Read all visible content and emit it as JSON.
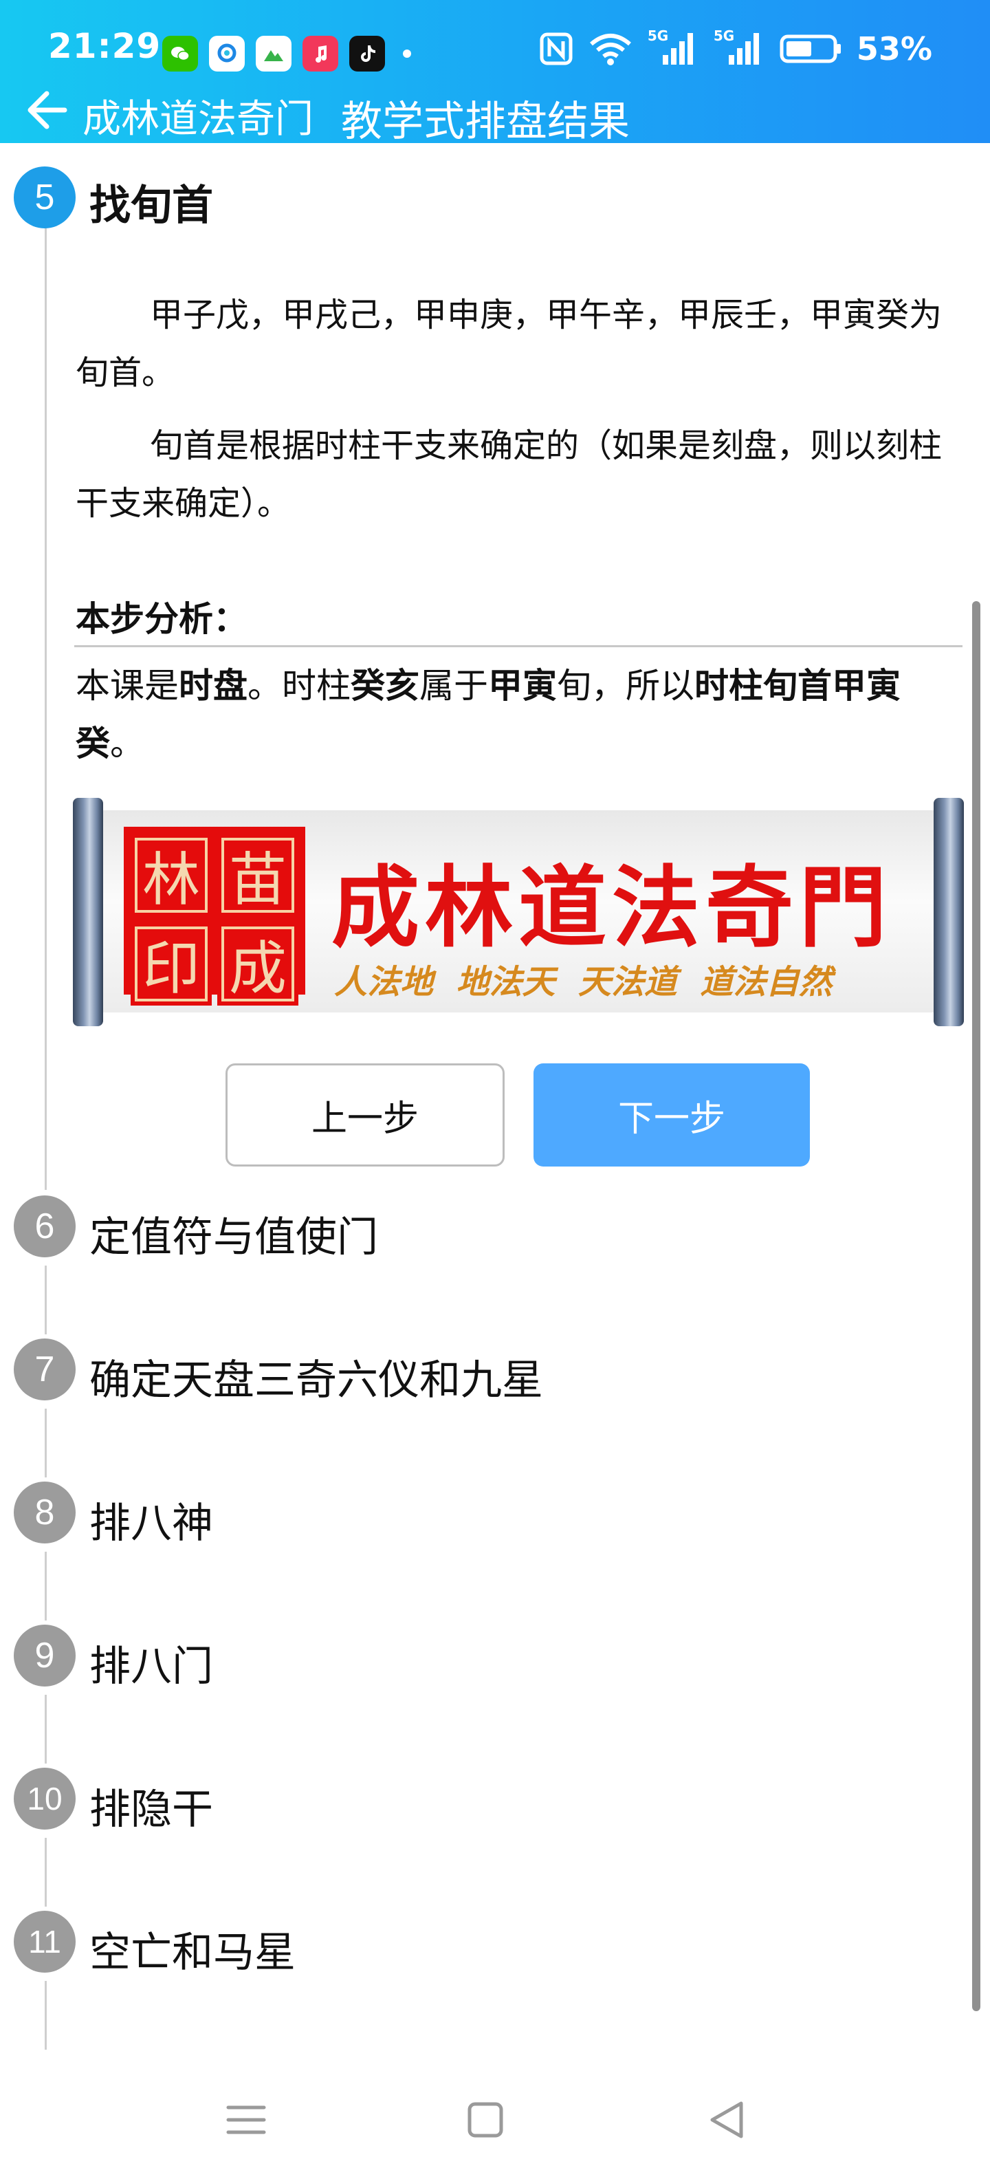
{
  "status_bar": {
    "time": "21:29",
    "notification_apps": [
      "wechat-icon",
      "qq-browser-icon",
      "photos-icon",
      "music-icon",
      "tiktok-icon"
    ],
    "network_1": "5G",
    "network_2": "5G",
    "battery": "53%"
  },
  "header": {
    "back_icon": "arrow-left-icon",
    "app_name": "成林道法奇门",
    "page_title": "教学式排盘结果"
  },
  "current_step": {
    "number": "5",
    "title": "找旬首",
    "paragraph_1": "甲子戊，甲戌己，甲申庚，甲午辛，甲辰壬，甲寅癸为旬首。",
    "paragraph_2": "旬首是根据时柱干支来确定的（如果是刻盘，则以刻柱干支来确定）。",
    "analysis_title": "本步分析：",
    "analysis": {
      "t1": "本课是",
      "b1": "时盘",
      "t2": "。时柱",
      "b2": "癸亥",
      "t3": "属于",
      "b3": "甲寅",
      "t4": "旬，所以",
      "b4": "时柱旬首甲寅癸",
      "t5": "。"
    }
  },
  "banner": {
    "seal_chars": [
      "林",
      "苗",
      "印",
      "成"
    ],
    "brand": "成林道法奇門",
    "motto": "人法地  地法天  天法道  道法自然"
  },
  "buttons": {
    "prev": "上一步",
    "next": "下一步"
  },
  "steps": [
    {
      "number": "6",
      "title": "定值符与值使门"
    },
    {
      "number": "7",
      "title": "确定天盘三奇六仪和九星"
    },
    {
      "number": "8",
      "title": "排八神"
    },
    {
      "number": "9",
      "title": "排八门"
    },
    {
      "number": "10",
      "title": "排隐干"
    },
    {
      "number": "11",
      "title": "空亡和马星"
    }
  ],
  "nav_bar": [
    "menu-icon",
    "home-icon",
    "back-triangle-icon"
  ],
  "colors": {
    "header_gradient_start": "#17c8f2",
    "header_gradient_end": "#208ef6",
    "active_step": "#1e9ee8",
    "inactive_step": "#9c9c9c",
    "next_button": "#4ea9ff",
    "brand_red": "#e01010"
  }
}
